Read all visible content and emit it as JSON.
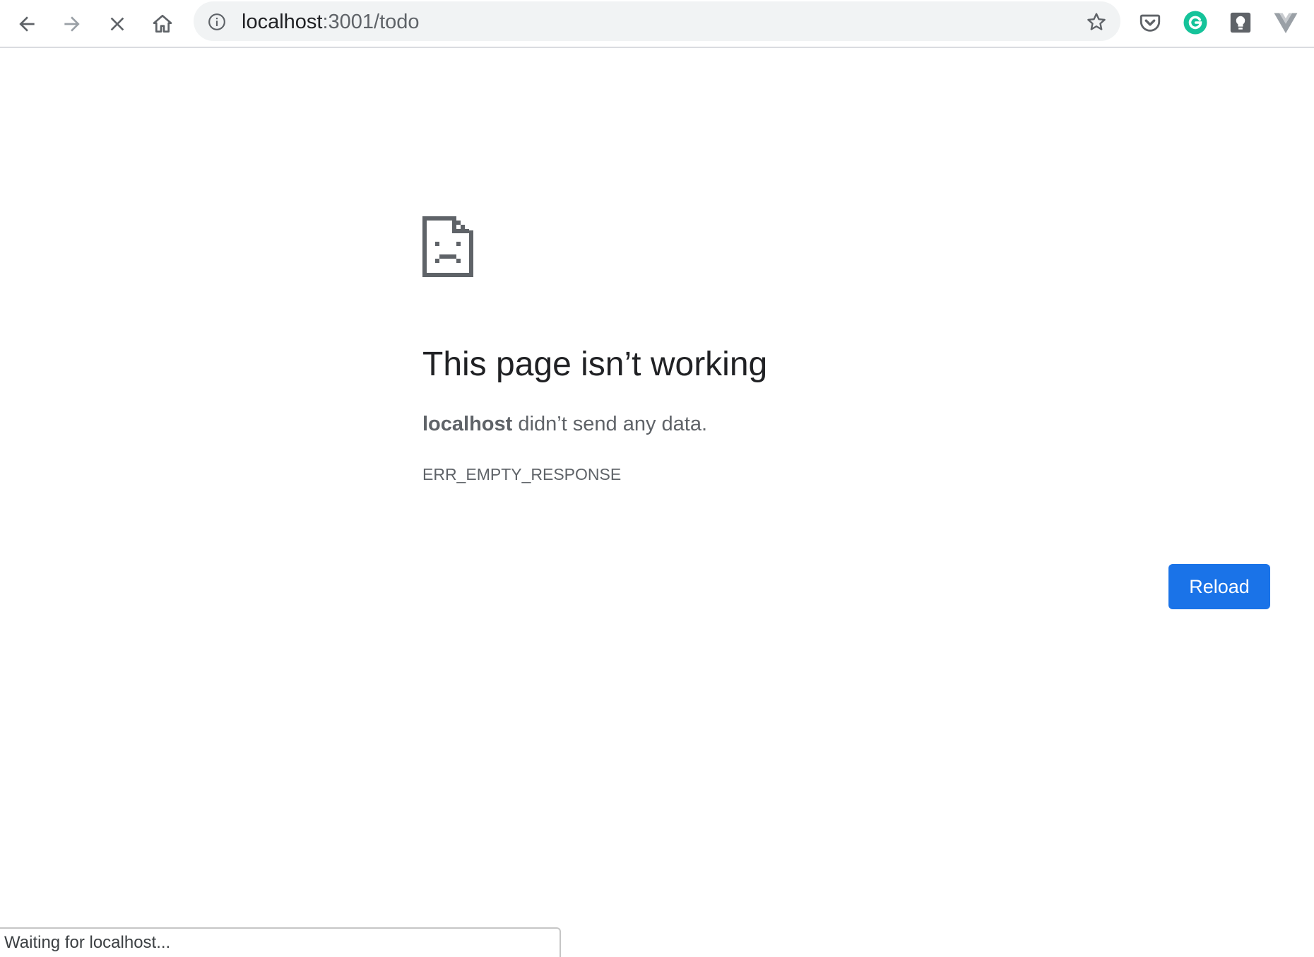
{
  "browser": {
    "url_host": "localhost",
    "url_path": ":3001/todo",
    "icons": {
      "back": "back-arrow-icon",
      "forward": "forward-arrow-icon",
      "stop": "stop-loading-icon",
      "home": "home-icon",
      "info": "site-info-icon",
      "bookmark": "bookmark-star-icon"
    },
    "extensions": [
      {
        "name": "pocket-extension-icon",
        "color": "#5f6368"
      },
      {
        "name": "grammarly-extension-icon",
        "color": "#15c39a",
        "glyph": "G"
      },
      {
        "name": "lightbulb-extension-icon",
        "color": "#5f6368"
      },
      {
        "name": "vue-devtools-extension-icon",
        "color": "#9aa0a6"
      }
    ]
  },
  "error_page": {
    "title": "This page isn’t working",
    "host": "localhost",
    "message": " didn’t send any data.",
    "code": "ERR_EMPTY_RESPONSE",
    "reload_label": "Reload",
    "icon": "sad-page-icon",
    "accent_color": "#1a73e8"
  },
  "status_bar": {
    "text": "Waiting for localhost..."
  }
}
